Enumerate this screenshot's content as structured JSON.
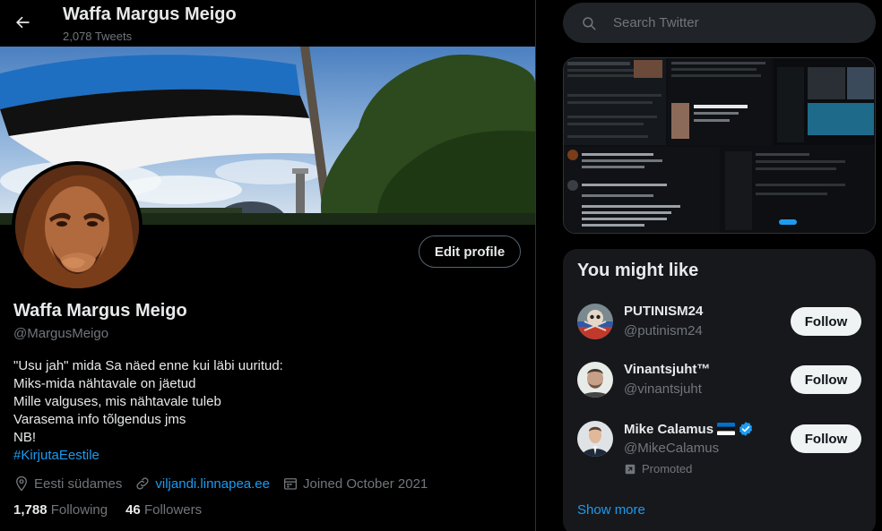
{
  "header": {
    "name": "Waffa Margus Meigo",
    "tweet_count": "2,078 Tweets",
    "back_icon": "arrow-left-icon"
  },
  "profile": {
    "edit_label": "Edit profile",
    "name": "Waffa Margus Meigo",
    "handle": "@MargusMeigo",
    "bio_lines": [
      "\"Usu jah\" mida Sa näed enne kui läbi uuritud:",
      "Miks-mida nähtavale on jäetud",
      "Mille valguses, mis nähtavale tuleb",
      "Varasema info tõlgendus jms",
      "NB!"
    ],
    "hashtag": "#KirjutaEestile",
    "location": "Eesti südames",
    "website": "viljandi.linnapea.ee",
    "joined": "Joined October 2021",
    "following_count": "1,788",
    "following_label": "Following",
    "followers_count": "46",
    "followers_label": "Followers"
  },
  "sidebar": {
    "search_placeholder": "Search Twitter",
    "wtf_title": "You might like",
    "suggestions": [
      {
        "name": "PUTINISM24",
        "handle": "@putinism24",
        "follow": "Follow"
      },
      {
        "name": "Vinantsjuht™",
        "handle": "@vinantsjuht",
        "follow": "Follow"
      },
      {
        "name": "Mike Calamus",
        "handle": "@MikeCalamus",
        "follow": "Follow",
        "promoted": "Promoted",
        "verified": true
      }
    ],
    "show_more": "Show more"
  },
  "colors": {
    "accent": "#1d9bf0",
    "background": "#000000",
    "card": "#16181c",
    "muted": "#71767b",
    "flag_blue": "#0072ce",
    "flag_black": "#000000",
    "flag_white": "#ffffff"
  }
}
